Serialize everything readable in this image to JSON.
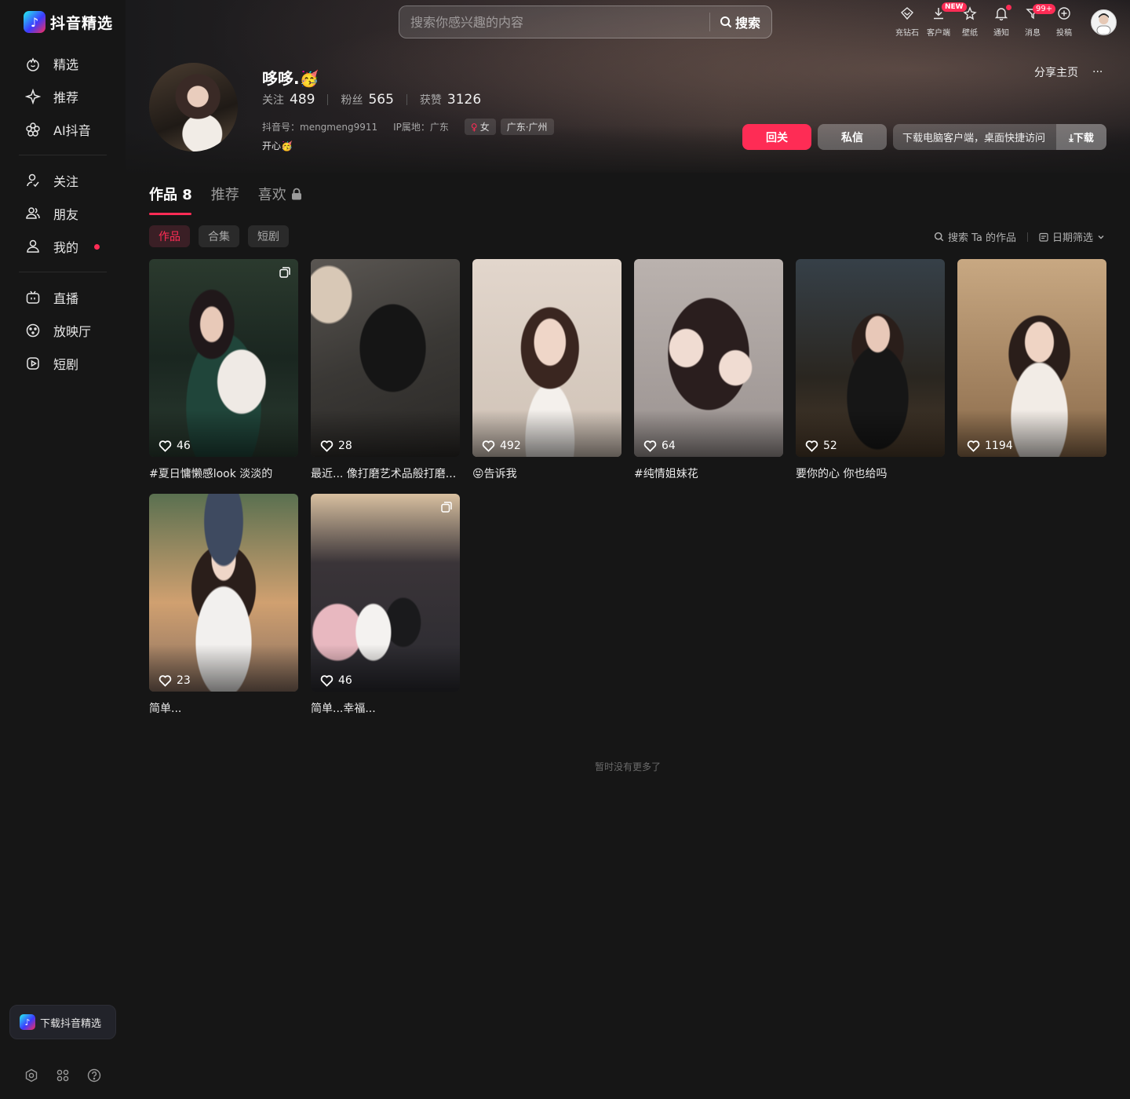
{
  "brand": {
    "name": "抖音精选"
  },
  "sidebar": {
    "groups": [
      [
        {
          "label": "精选",
          "icon": "home-icon"
        },
        {
          "label": "推荐",
          "icon": "sparkle-icon"
        },
        {
          "label": "AI抖音",
          "icon": "ai-flower-icon"
        }
      ],
      [
        {
          "label": "关注",
          "icon": "follow-user-icon"
        },
        {
          "label": "朋友",
          "icon": "friends-icon"
        },
        {
          "label": "我的",
          "icon": "me-icon",
          "dot": true
        }
      ],
      [
        {
          "label": "直播",
          "icon": "tv-icon"
        },
        {
          "label": "放映厅",
          "icon": "theater-icon"
        },
        {
          "label": "短剧",
          "icon": "short-drama-icon"
        }
      ]
    ],
    "download_label": "下载抖音精选"
  },
  "search": {
    "placeholder": "搜索你感兴趣的内容",
    "button_label": "搜索"
  },
  "topbar": {
    "items": [
      {
        "label": "充钻石",
        "icon": "diamond-icon"
      },
      {
        "label": "客户端",
        "icon": "download-icon",
        "badge": "NEW"
      },
      {
        "label": "壁纸",
        "icon": "wallpaper-icon"
      },
      {
        "label": "通知",
        "icon": "bell-icon",
        "dot": true
      },
      {
        "label": "消息",
        "icon": "message-icon",
        "badge": "99+"
      },
      {
        "label": "投稿",
        "icon": "upload-icon"
      }
    ]
  },
  "profile": {
    "name": "哆哆.🥳",
    "stats": [
      {
        "label": "关注",
        "value": "489"
      },
      {
        "label": "粉丝",
        "value": "565"
      },
      {
        "label": "获赞",
        "value": "3126"
      }
    ],
    "douyin_id": "抖音号：mengmeng9911",
    "ip_location": "IP属地：广东",
    "gender_tag": "女",
    "region_tag": "广东·广州",
    "signature": "开心🥳",
    "share_label": "分享主页",
    "more_label": "···",
    "follow_back_label": "回关",
    "message_label": "私信",
    "desktop_promo": "下载电脑客户端，桌面快捷访问",
    "desktop_download": "⤓下载"
  },
  "tabs": [
    {
      "label": "作品 8",
      "active": true
    },
    {
      "label": "推荐",
      "active": false
    },
    {
      "label": "喜欢",
      "active": false,
      "locked": true
    }
  ],
  "subtabs": [
    {
      "label": "作品",
      "active": true
    },
    {
      "label": "合集",
      "active": false
    },
    {
      "label": "短剧",
      "active": false
    }
  ],
  "tools": {
    "search_works": "搜索 Ta 的作品",
    "date_filter": "日期筛选"
  },
  "videos": [
    {
      "likes": "46",
      "caption": "#夏日慵懒感look 淡淡的",
      "multi": true
    },
    {
      "likes": "28",
      "caption": "最近... 像打磨艺术品般打磨...",
      "multi": false
    },
    {
      "likes": "492",
      "caption": "😝告诉我",
      "multi": false
    },
    {
      "likes": "64",
      "caption": "#纯情姐妹花",
      "multi": false
    },
    {
      "likes": "52",
      "caption": "要你的心 你也给吗",
      "multi": false
    },
    {
      "likes": "1194",
      "caption": "",
      "multi": false
    },
    {
      "likes": "23",
      "caption": "简单...",
      "multi": false
    },
    {
      "likes": "46",
      "caption": "简单...幸福...",
      "multi": true
    }
  ],
  "footer": {
    "no_more": "暂时没有更多了"
  }
}
